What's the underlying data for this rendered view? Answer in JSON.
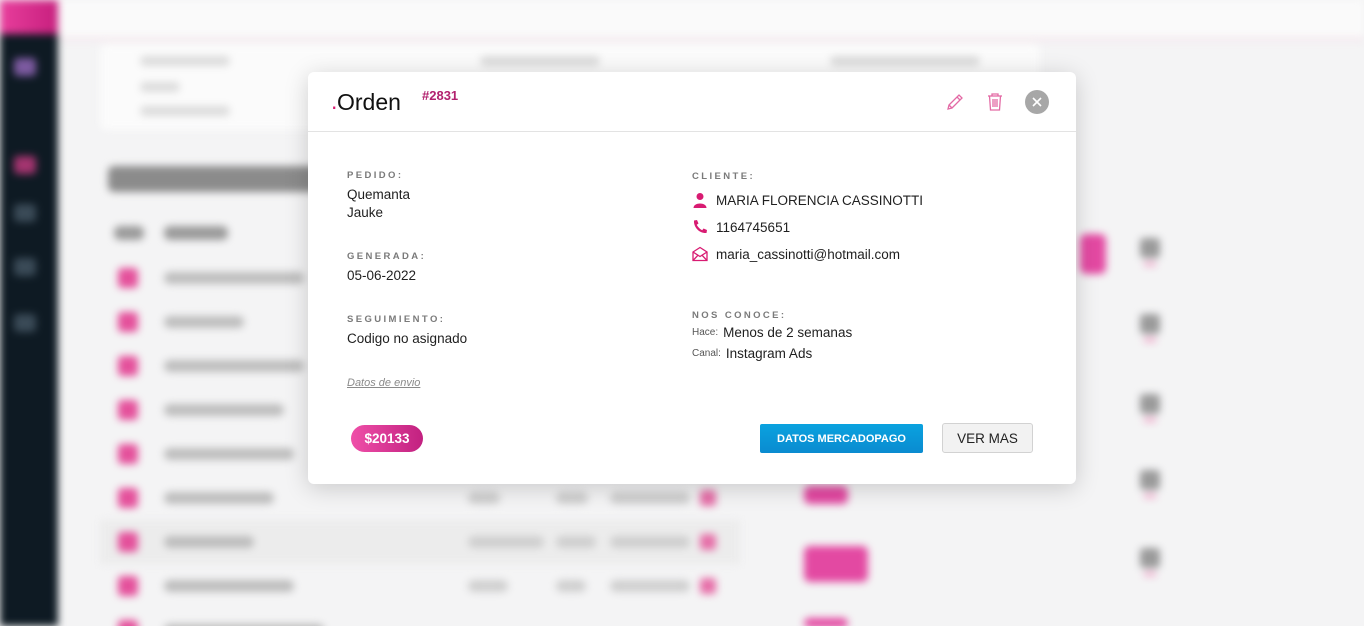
{
  "modal": {
    "title_dot": ".",
    "title": "Orden",
    "order_number": "#2831",
    "pedido_label": "PEDIDO:",
    "pedido_lines": [
      "Quemanta",
      "Jauke"
    ],
    "generada_label": "GENERADA:",
    "generada_value": "05-06-2022",
    "seguimiento_label": "SEGUIMIENTO:",
    "seguimiento_value": "Codigo no asignado",
    "datos_envio_link": "Datos de envio",
    "cliente_label": "CLIENTE:",
    "cliente_name": "MARIA FLORENCIA CASSINOTTI",
    "cliente_phone": "1164745651",
    "cliente_email": "maria_cassinotti@hotmail.com",
    "nos_conoce_label": "NOS CONOCE:",
    "hace_label": "Hace:",
    "hace_value": "Menos de 2 semanas",
    "canal_label": "Canal:",
    "canal_value": "Instagram Ads",
    "price": "$20133",
    "mercadopago_button": "DATOS MERCADOPAGO",
    "ver_mas_button": "VER MAS"
  },
  "icons": {
    "edit": "pencil-icon",
    "delete": "trash-icon",
    "close": "close-icon",
    "person": "person-icon",
    "phone": "phone-icon",
    "email": "envelope-icon"
  },
  "colors": {
    "accent_pink": "#d81b72",
    "mercadopago_blue": "#0a94d6",
    "sidebar_dark": "#0e1a23"
  }
}
